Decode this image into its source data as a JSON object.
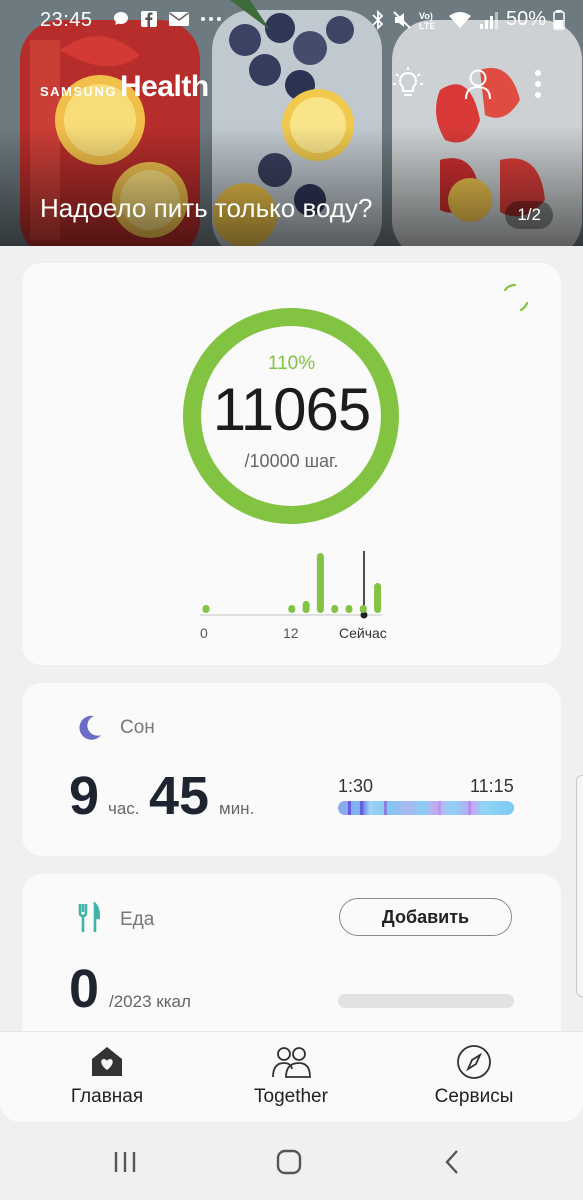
{
  "status_bar": {
    "time": "23:45",
    "battery": "50%",
    "icons": [
      "chat-bubble-icon",
      "facebook-icon",
      "mail-icon",
      "more-dots-icon",
      "bluetooth-icon",
      "mute-icon",
      "volte-icon",
      "wifi-icon",
      "signal-icon",
      "battery-icon"
    ]
  },
  "brand": {
    "samsung": "SAMSUNG",
    "health": "Health"
  },
  "hero": {
    "title": "Надоело пить только воду?",
    "page_indicator": "1/2"
  },
  "steps": {
    "percent": "110%",
    "count": "11065",
    "goal": "/10000 шаг.",
    "progress": 1.0,
    "accent_color": "#82c341",
    "hourly_levels": [
      0.12,
      0,
      0,
      0,
      0,
      0,
      0.12,
      0.2,
      1.0,
      0.12,
      0.12,
      0.12,
      0.5,
      0
    ],
    "axis_labels": [
      "0",
      "12",
      "Сейчас"
    ]
  },
  "sleep": {
    "label": "Сон",
    "hours": "9",
    "hours_unit": "час.",
    "minutes": "45",
    "minutes_unit": "мин.",
    "start": "1:30",
    "end": "11:15"
  },
  "food": {
    "label": "Еда",
    "add_label": "Добавить",
    "calories": "0",
    "goal": "/2023 ккал",
    "progress": 0
  },
  "nav": {
    "home": "Главная",
    "together": "Together",
    "services": "Сервисы"
  }
}
